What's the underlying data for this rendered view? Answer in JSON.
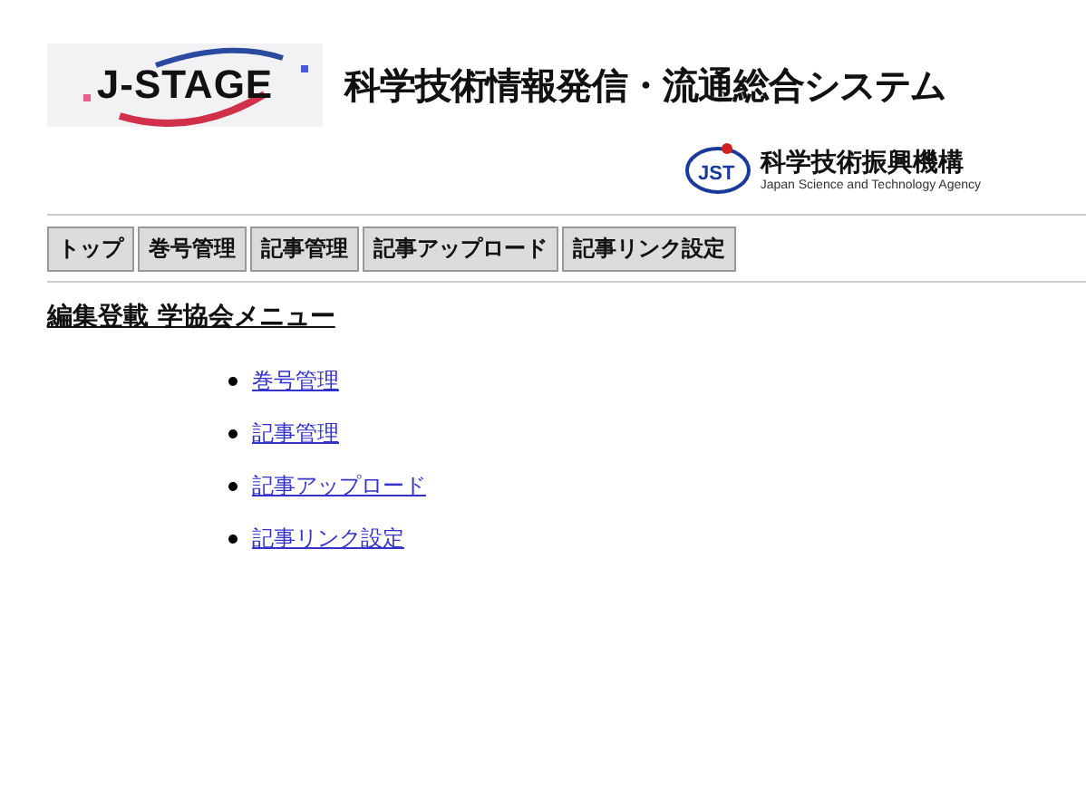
{
  "header": {
    "logo_text": "J-STAGE",
    "system_title": "科学技術情報発信・流通総合システム",
    "agency_logo_text": "JST",
    "agency_name": "科学技術振興機構",
    "agency_name_en": "Japan Science and Technology Agency"
  },
  "nav": [
    {
      "label": "トップ"
    },
    {
      "label": "巻号管理"
    },
    {
      "label": "記事管理"
    },
    {
      "label": "記事アップロード"
    },
    {
      "label": "記事リンク設定"
    }
  ],
  "heading": "編集登載 学協会メニュー",
  "menu": [
    {
      "label": "巻号管理"
    },
    {
      "label": "記事管理"
    },
    {
      "label": "記事アップロード"
    },
    {
      "label": "記事リンク設定"
    }
  ]
}
